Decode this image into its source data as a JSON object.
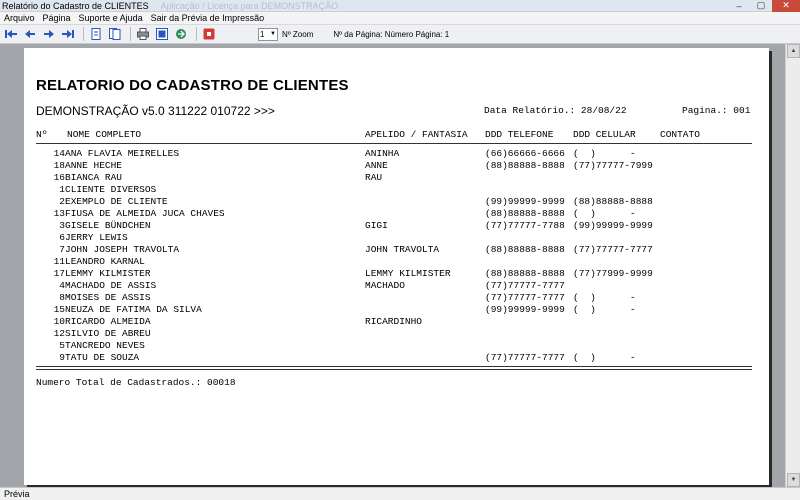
{
  "window": {
    "title": "Relatório do Cadastro de CLIENTES",
    "faded_title": "Aplicação / Licença para DEMONSTRAÇÃO",
    "controls": [
      "–",
      "▢",
      "✕"
    ]
  },
  "menu": [
    "Arquivo",
    "Página",
    "Suporte e Ajuda",
    "Sair da Prévia de Impressão"
  ],
  "toolbar": {
    "nav_icons": [
      "first-page-icon",
      "prev-page-icon",
      "next-page-icon",
      "last-page-icon"
    ],
    "view_icons": [
      "single-page-icon",
      "two-pages-icon"
    ],
    "print_icons": [
      "printer-icon",
      "setup-icon",
      "export-icon",
      "stop-icon"
    ],
    "zoom_value": "1",
    "zoom_label": "Nº Zoom",
    "page_label": "Nº da Página: Número Página: 1"
  },
  "report": {
    "title": "RELATORIO DO CADASTRO DE CLIENTES",
    "subtitle": "DEMONSTRAÇÃO v5.0 311222 010722 >>>",
    "date": "Data Relatório.: 28/08/22",
    "page": "Pagina.: 001",
    "columns": {
      "id": "Nº",
      "nome": "NOME COMPLETO",
      "apelido": "APELIDO / FANTASIA",
      "telefone": "DDD TELEFONE",
      "celular": "DDD CELULAR",
      "contato": "CONTATO"
    },
    "rows": [
      {
        "id": "14",
        "nome": "ANA FLAVIA MEIRELLES",
        "apelido": "ANINHA",
        "telefone": "(66)66666-6666",
        "celular": "(  )      -",
        "contato": ""
      },
      {
        "id": "18",
        "nome": "ANNE HECHE",
        "apelido": "ANNE",
        "telefone": "(88)88888-8888",
        "celular": "(77)77777-7999",
        "contato": ""
      },
      {
        "id": "16",
        "nome": "BIANCA RAU",
        "apelido": "RAU",
        "telefone": "",
        "celular": "",
        "contato": ""
      },
      {
        "id": "1",
        "nome": "CLIENTE DIVERSOS",
        "apelido": "",
        "telefone": "",
        "celular": "",
        "contato": ""
      },
      {
        "id": "2",
        "nome": "EXEMPLO DE CLIENTE",
        "apelido": "",
        "telefone": "(99)99999-9999",
        "celular": "(88)88888-8888",
        "contato": ""
      },
      {
        "id": "13",
        "nome": "FIUSA DE ALMEIDA JUCA CHAVES",
        "apelido": "",
        "telefone": "(88)88888-8888",
        "celular": "(  )      -",
        "contato": ""
      },
      {
        "id": "3",
        "nome": "GISELE BÜNDCHEN",
        "apelido": "GIGI",
        "telefone": "(77)77777-7788",
        "celular": "(99)99999-9999",
        "contato": ""
      },
      {
        "id": "6",
        "nome": "JERRY LEWIS",
        "apelido": "",
        "telefone": "",
        "celular": "",
        "contato": ""
      },
      {
        "id": "7",
        "nome": "JOHN JOSEPH TRAVOLTA",
        "apelido": "JOHN TRAVOLTA",
        "telefone": "(88)88888-8888",
        "celular": "(77)77777-7777",
        "contato": ""
      },
      {
        "id": "11",
        "nome": "LEANDRO KARNAL",
        "apelido": "",
        "telefone": "",
        "celular": "",
        "contato": ""
      },
      {
        "id": "17",
        "nome": "LEMMY KILMISTER",
        "apelido": "LEMMY KILMISTER",
        "telefone": "(88)88888-8888",
        "celular": "(77)77999-9999",
        "contato": ""
      },
      {
        "id": "4",
        "nome": "MACHADO DE ASSIS",
        "apelido": "MACHADO",
        "telefone": "(77)77777-7777",
        "celular": "",
        "contato": ""
      },
      {
        "id": "8",
        "nome": "MOISES DE ASSIS",
        "apelido": "",
        "telefone": "(77)77777-7777",
        "celular": "(  )      -",
        "contato": ""
      },
      {
        "id": "15",
        "nome": "NEUZA DE FATIMA DA SILVA",
        "apelido": "",
        "telefone": "(99)99999-9999",
        "celular": "(  )      -",
        "contato": ""
      },
      {
        "id": "10",
        "nome": "RICARDO ALMEIDA",
        "apelido": "RICARDINHO",
        "telefone": "",
        "celular": "",
        "contato": ""
      },
      {
        "id": "12",
        "nome": "SILVIO DE ABREU",
        "apelido": "",
        "telefone": "",
        "celular": "",
        "contato": ""
      },
      {
        "id": "5",
        "nome": "TANCREDO NEVES",
        "apelido": "",
        "telefone": "",
        "celular": "",
        "contato": ""
      },
      {
        "id": "9",
        "nome": "TATU DE SOUZA",
        "apelido": "",
        "telefone": "(77)77777-7777",
        "celular": "(  )      -",
        "contato": ""
      }
    ],
    "total": "Numero Total de Cadastrados.: 00018"
  },
  "status": {
    "text": "Prévia"
  }
}
